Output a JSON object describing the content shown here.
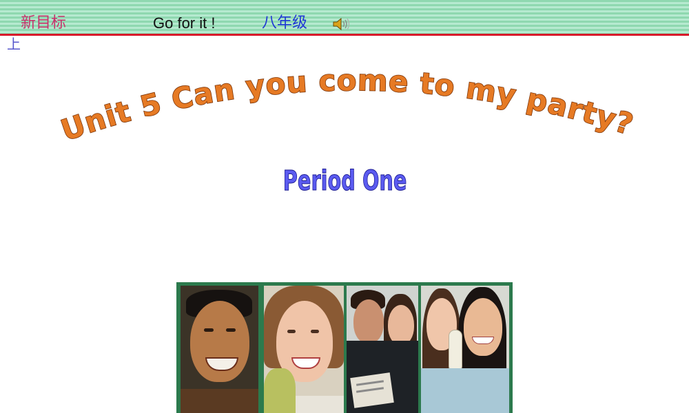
{
  "header": {
    "series": "新目标",
    "brand": "Go for it !",
    "grade": "八年级",
    "volume": "上",
    "icons": [
      "speaker-icon"
    ]
  },
  "title": {
    "main": "Unit 5  Can you come to my party?",
    "subtitle": "Period  One"
  },
  "colors": {
    "header_green": "#8fd8b0",
    "header_line": "#d8182a",
    "title_orange": "#e67a24",
    "subtitle_blue": "#5b5bf0",
    "photo_frame": "#2c7a4d"
  }
}
